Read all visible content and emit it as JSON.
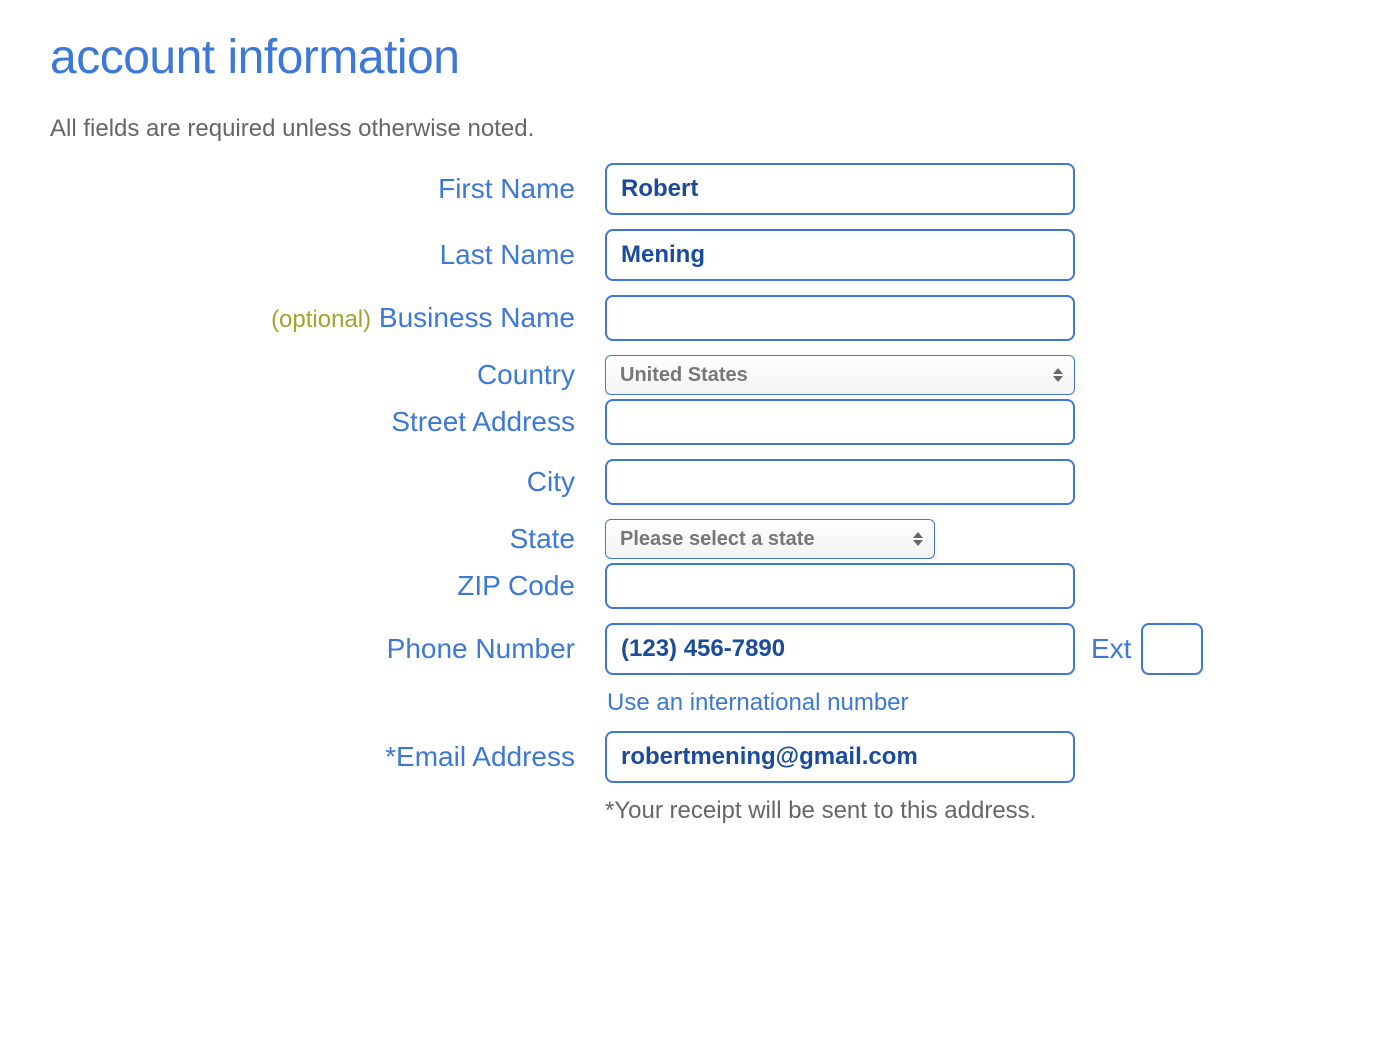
{
  "title": "account information",
  "subtitle": "All fields are required unless otherwise noted.",
  "labels": {
    "first_name": "First Name",
    "last_name": "Last Name",
    "business_name": "Business Name",
    "optional": "(optional)",
    "country": "Country",
    "street_address": "Street Address",
    "city": "City",
    "state": "State",
    "zip_code": "ZIP Code",
    "phone_number": "Phone Number",
    "ext": "Ext",
    "email_address": "Email Address",
    "asterisk": "*"
  },
  "values": {
    "first_name": "Robert",
    "last_name": "Mening",
    "business_name": "",
    "country": "United States",
    "street_address": "",
    "city": "",
    "state": "Please select a state",
    "zip_code": "",
    "phone_number": "(123) 456-7890",
    "ext": "",
    "email": "robertmening@gmail.com"
  },
  "helpers": {
    "intl_number": "Use an international number",
    "receipt_note": "*Your receipt will be sent to this address."
  }
}
